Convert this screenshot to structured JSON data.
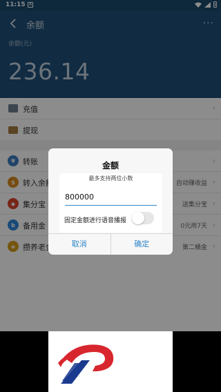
{
  "status_bar": {
    "time": "11:15",
    "notif": "A"
  },
  "header": {
    "title": "余额",
    "more": "···",
    "balance_label": "余额(元)",
    "balance": "236.14"
  },
  "rows": [
    {
      "label": "充值",
      "sub": "",
      "icon": "recharge-icon",
      "color": "#6d7f91"
    },
    {
      "label": "提现",
      "sub": "",
      "icon": "withdraw-icon",
      "color": "#a67c43"
    },
    {
      "label": "转账",
      "sub": "",
      "icon": "transfer-icon",
      "color": "#3b7bbf",
      "glyph": "¥"
    },
    {
      "label": "转入余额宝",
      "sub": "自动赚收益",
      "icon": "money-bag-icon",
      "color": "#d98a1f",
      "glyph": "$"
    },
    {
      "label": "集分宝",
      "sub": "送集分宝",
      "icon": "points-icon",
      "color": "#d8452b",
      "glyph": "◆"
    },
    {
      "label": "备用金",
      "sub": "0元用7天",
      "icon": "reserve-icon",
      "color": "#2e86d8",
      "glyph": "b"
    },
    {
      "label": "攒养老金",
      "sub": "第二桶金",
      "icon": "pension-icon",
      "color": "#d69c1a",
      "glyph": "◈"
    }
  ],
  "dialog": {
    "title": "金额",
    "hint": "最多支持两位小数",
    "amount": "800000",
    "voice_label": "固定金额进行语音播报",
    "voice_on": false,
    "cancel": "取消",
    "confirm": "确定"
  },
  "colors": {
    "header": "#1e4f78",
    "accent": "#2f86c8",
    "logo_red": "#d8262e",
    "logo_blue": "#1a3a8f"
  }
}
